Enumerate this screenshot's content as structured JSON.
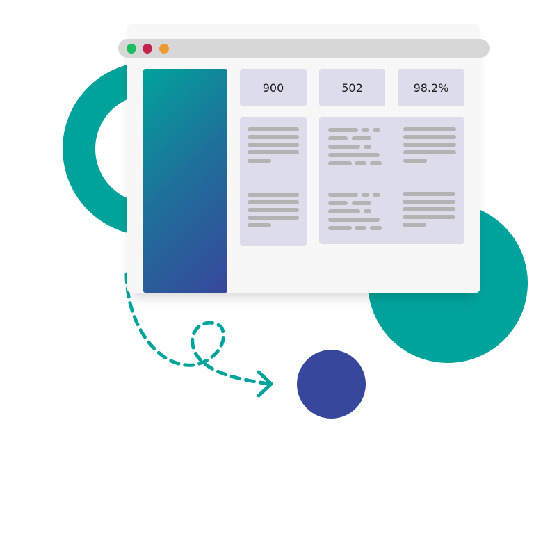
{
  "illustration": {
    "stats": [
      {
        "value": "900"
      },
      {
        "value": "502"
      },
      {
        "value": "98.2%"
      }
    ],
    "window_dots": [
      "green-dot",
      "red-dot",
      "orange-dot"
    ],
    "colors": {
      "teal": "#00a39b",
      "navy": "#37479b",
      "panel": "#dcdcea",
      "window_bg": "#f7f7f7",
      "titlebar": "#d7d7d7",
      "placeholder_line": "#b3b3b3"
    }
  }
}
